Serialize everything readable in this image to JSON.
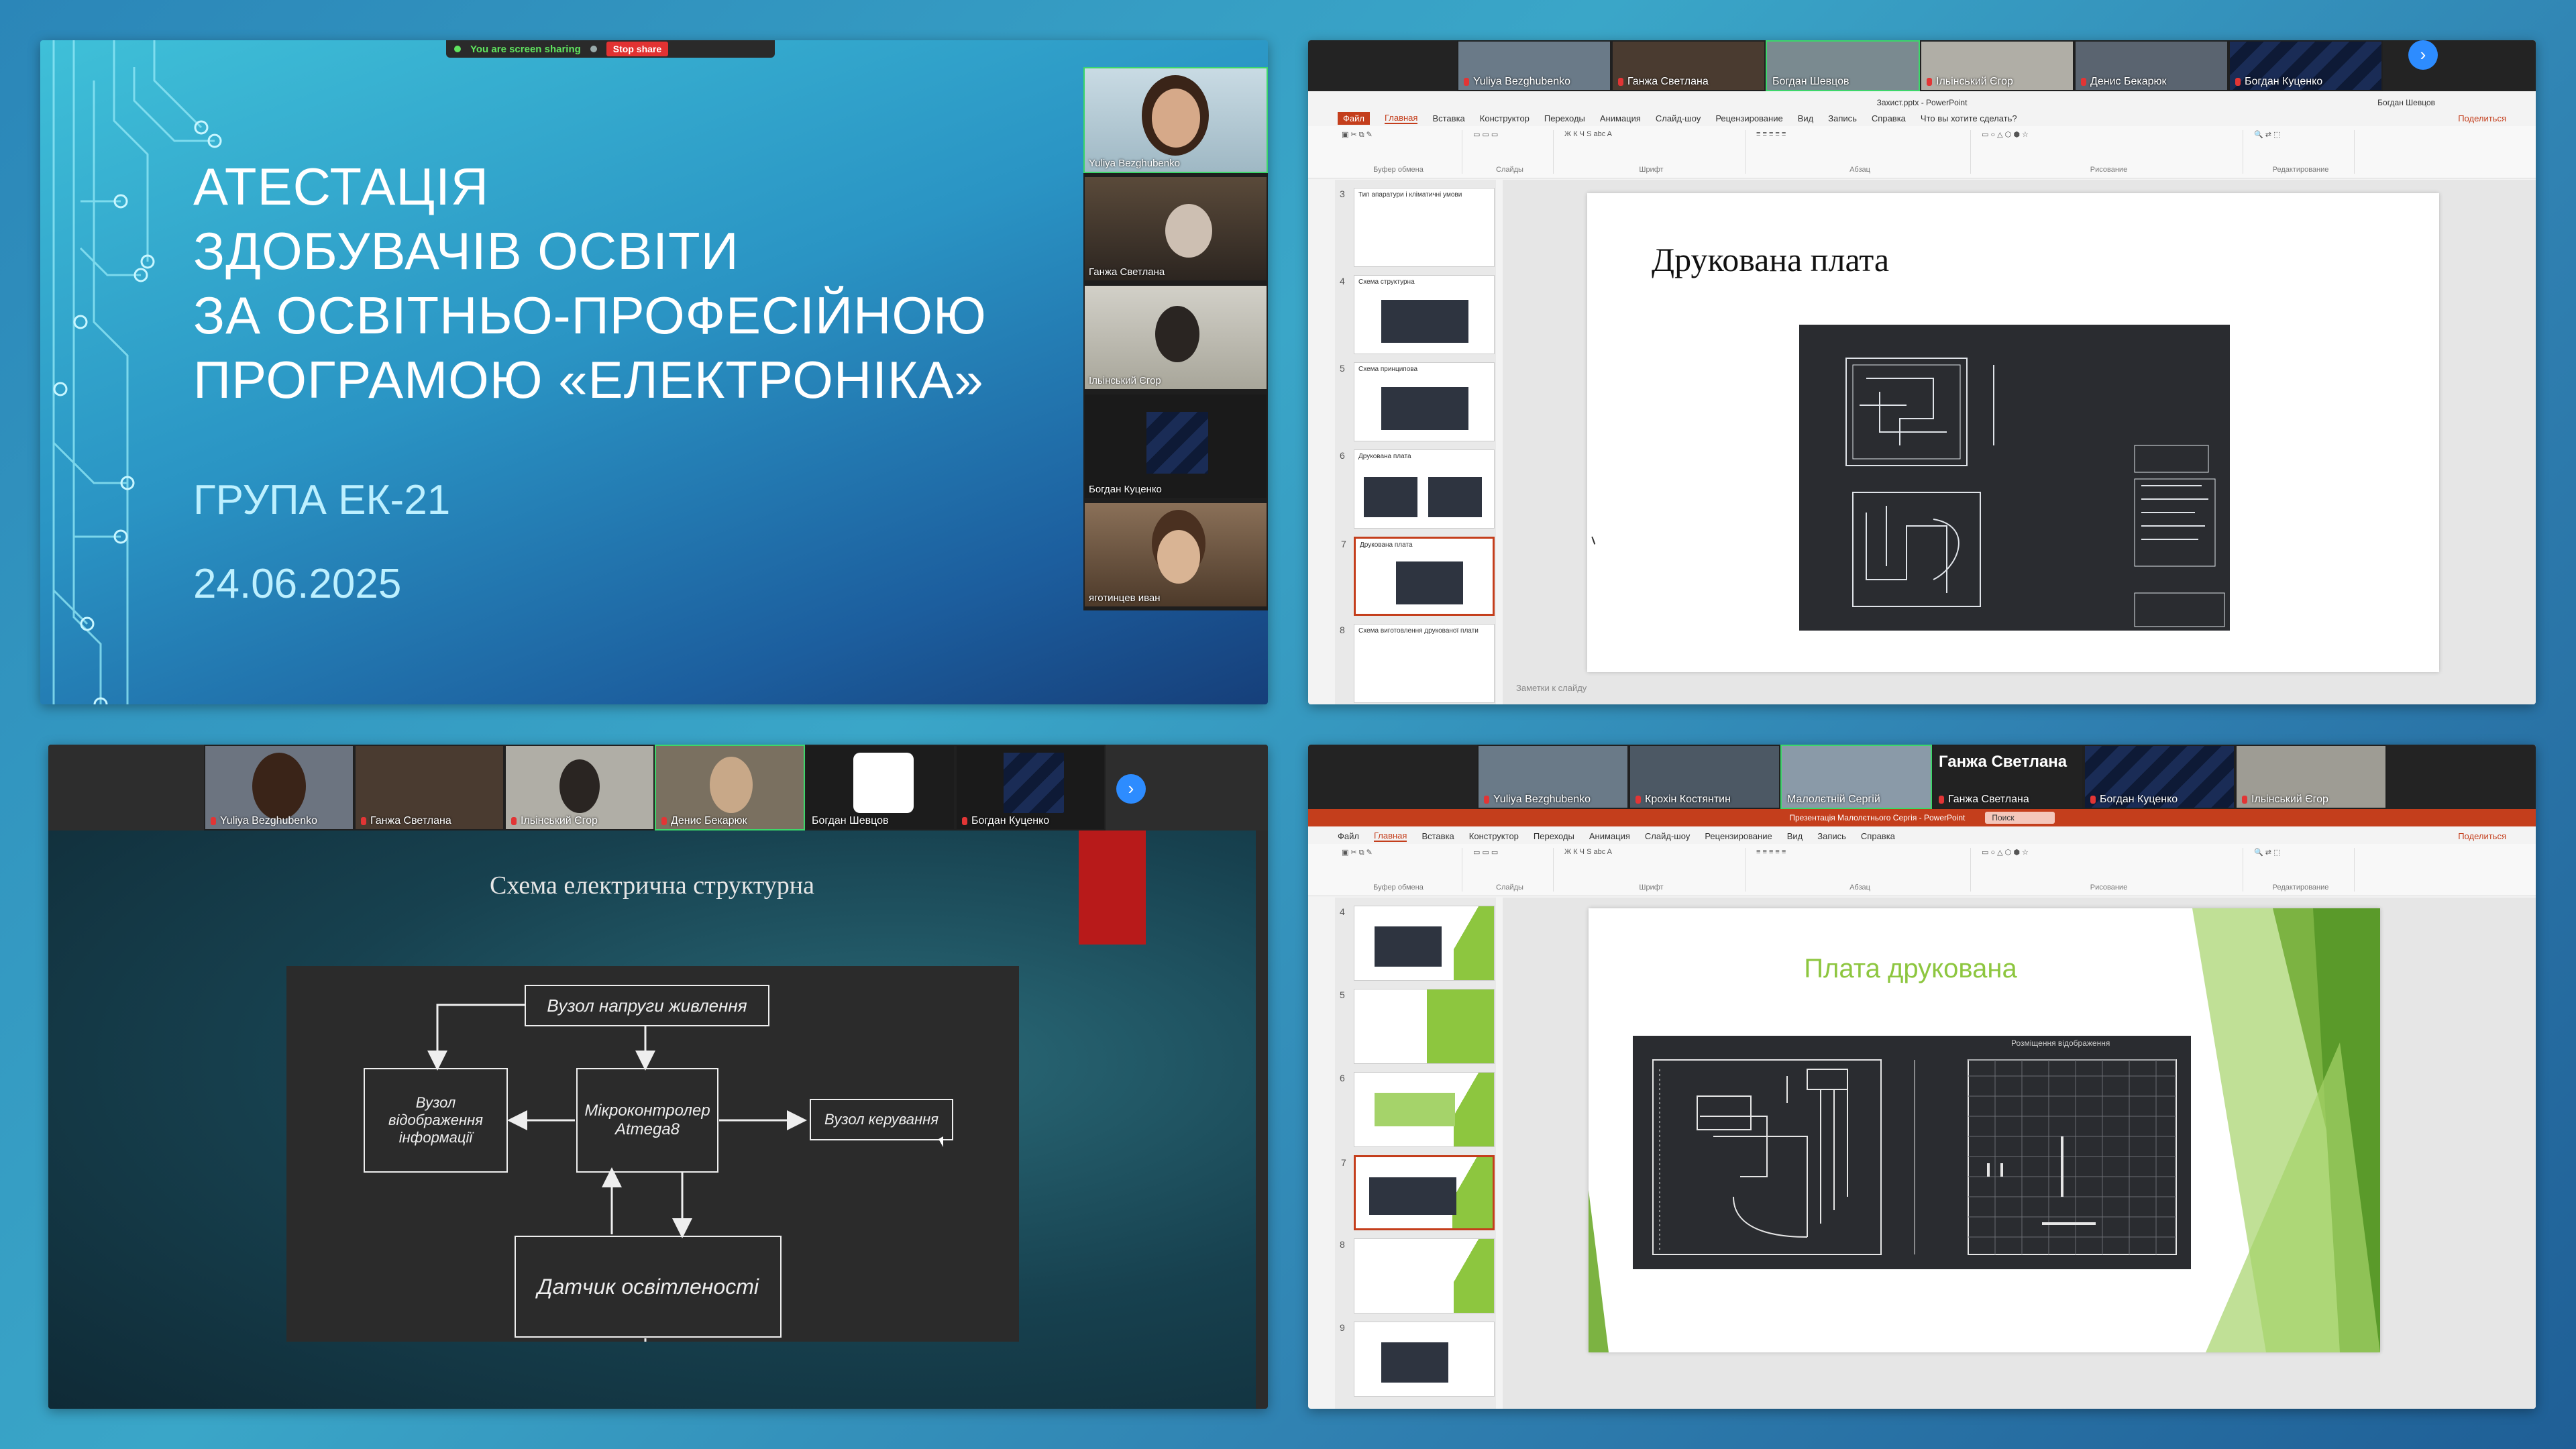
{
  "panel1": {
    "title_lines": [
      "АТЕСТАЦІЯ",
      "ЗДОБУВАЧІВ ОСВІТИ",
      "ЗА ОСВІТНЬО-ПРОФЕСІЙНОЮ",
      "ПРОГРАМОЮ «ЕЛЕКТРОНІКА»"
    ],
    "group": "ГРУПА ЕК-21",
    "date": "24.06.2025",
    "share_text": "You are screen sharing",
    "stop_label": "Stop share",
    "participants": [
      "Yuliya Bezghubenko",
      "Ганжа Светлана",
      "Ільінський Єгор",
      "Богдан Куценко",
      "яготинцев иван"
    ]
  },
  "panel2": {
    "participants": [
      "Yuliya Bezghubenko",
      "Ганжа Светлана",
      "Богдан Шевцов",
      "Ільінський Єгор",
      "Денис Бекарюк",
      "Богдан Куценко"
    ],
    "window_title": "Захист.pptx - PowerPoint",
    "user": "Богдан Шевцов",
    "tabs": [
      "Файл",
      "Главная",
      "Вставка",
      "Конструктор",
      "Переходы",
      "Анимация",
      "Слайд-шоу",
      "Рецензирование",
      "Вид",
      "Запись",
      "Справка",
      "Что вы хотите сделать?"
    ],
    "share_label": "Поделиться",
    "ribbon_groups": [
      "Буфер обмена",
      "Слайды",
      "Шрифт",
      "Абзац",
      "Рисование",
      "Редактирование"
    ],
    "thumbs": [
      {
        "n": "3",
        "t": "Тип апаратури і кліматичні умови"
      },
      {
        "n": "4",
        "t": "Схема структурна"
      },
      {
        "n": "5",
        "t": "Схема принципова"
      },
      {
        "n": "6",
        "t": "Друкована плата"
      },
      {
        "n": "7",
        "t": "Друкована плата"
      },
      {
        "n": "8",
        "t": "Схема виготовлення друкованої плати"
      }
    ],
    "slide_title": "Друкована плата",
    "notes": "Заметки к слайду"
  },
  "panel3": {
    "participants": [
      "Yuliya Bezghubenko",
      "Ганжа Светлана",
      "Ільінський Єгор",
      "Денис Бекарюк",
      "Богдан Шевцов",
      "Богдан Куценко"
    ],
    "slide_title": "Схема електрична структурна",
    "blocks": {
      "power": "Вузол напруги живлення",
      "display": "Вузол відображення інформації",
      "mcu": "Мікроконтролер Atmega8",
      "control": "Вузол керування",
      "sensor": "Датчик освітленості"
    }
  },
  "panel4": {
    "participants": [
      "Yuliya Bezghubenko",
      "Крохін Костянтин",
      "Малолєтній Сергій",
      "Ганжа Светлана",
      "Богдан Куценко",
      "Ільінський Єгор"
    ],
    "speaker": "Ганжа Светлана",
    "window_title": "Презентація Малолєтнього Сергія - PowerPoint",
    "search": "Поиск",
    "tabs": [
      "Файл",
      "Главная",
      "Вставка",
      "Конструктор",
      "Переходы",
      "Анимация",
      "Слайд-шоу",
      "Рецензирование",
      "Вид",
      "Запись",
      "Справка"
    ],
    "share_label": "Поделиться",
    "ribbon_groups": [
      "Буфер обмена",
      "Слайды",
      "Шрифт",
      "Абзац",
      "Рисование",
      "Редактирование"
    ],
    "thumb_numbers": [
      "4",
      "5",
      "6",
      "7",
      "8",
      "9"
    ],
    "slide_title": "Плата друкована",
    "drawing_label": "Розміщення  відображення"
  }
}
